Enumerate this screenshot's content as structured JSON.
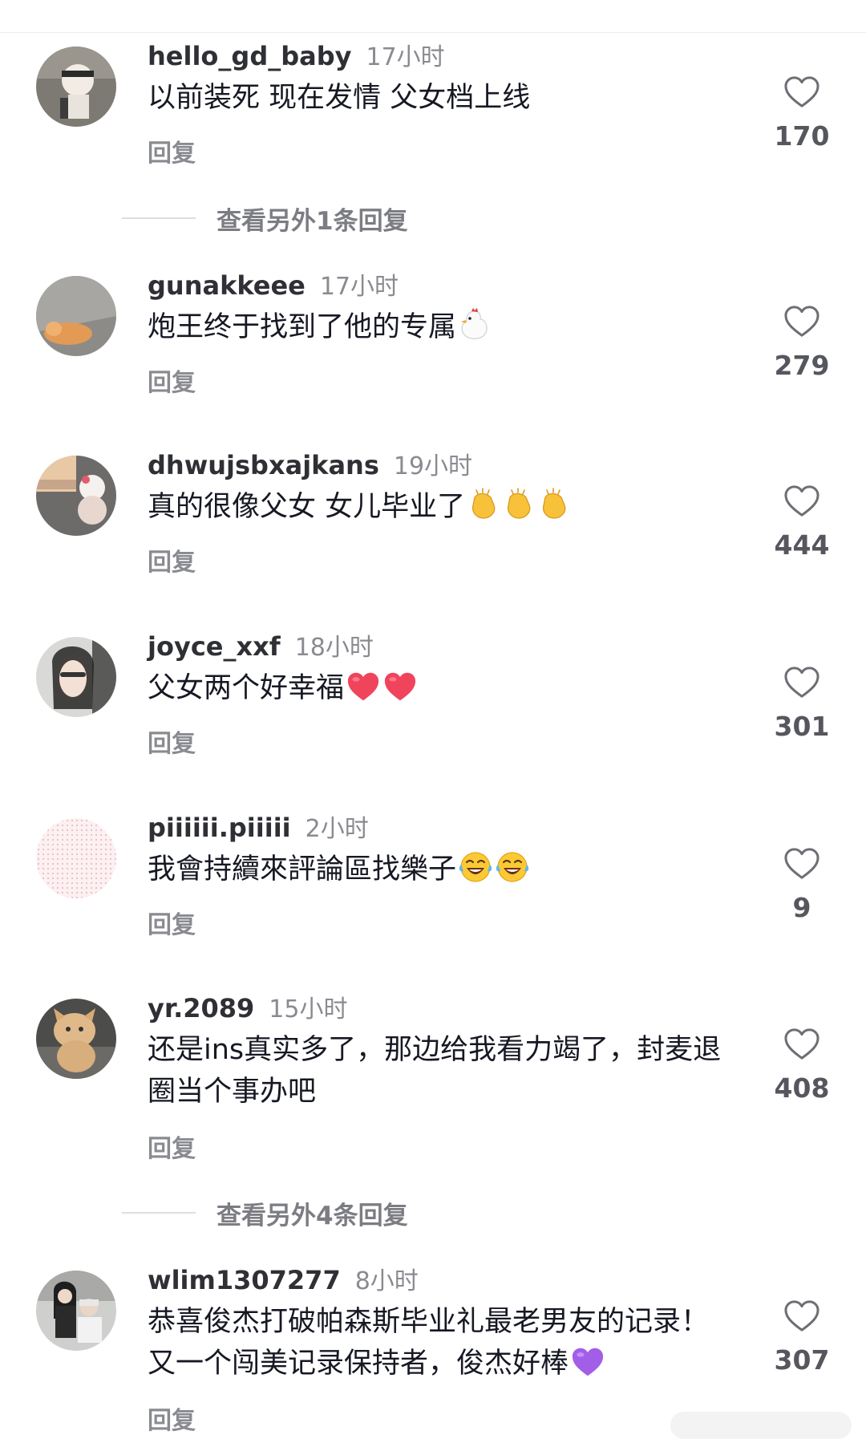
{
  "reply_label": "回复",
  "comments": [
    {
      "user": "hello_gd_baby",
      "time": "17小时",
      "text": "以前装死  现在发情 父女档上线",
      "likes": "170",
      "emoji": []
    },
    {
      "user": "gunakkeee",
      "time": "17小时",
      "text": "炮王终于找到了他的专属",
      "likes": "279",
      "emoji": [
        "chicken"
      ]
    },
    {
      "user": "dhwujsbxajkans",
      "time": "19小时",
      "text": "真的很像父女 女儿毕业了",
      "likes": "444",
      "emoji": [
        "clap",
        "clap",
        "clap"
      ]
    },
    {
      "user": "joyce_xxf",
      "time": "18小时",
      "text": "父女两个好幸福",
      "likes": "301",
      "emoji": [
        "heart-red",
        "heart-red"
      ]
    },
    {
      "user": "piiiiii.piiiii",
      "time": "2小时",
      "text": "我會持續來評論區找樂子",
      "likes": "9",
      "emoji": [
        "laugh",
        "laugh"
      ]
    },
    {
      "user": "yr.2089",
      "time": "15小时",
      "text": "还是ins真实多了，那边给我看力竭了，封麦退圈当个事办吧",
      "likes": "408",
      "emoji": []
    },
    {
      "user": "wlim1307277",
      "time": "8小时",
      "text": "恭喜俊杰打破帕森斯毕业礼最老男友的记录！又一个闯美记录保持者，俊杰好棒",
      "likes": "307",
      "emoji": [
        "heart-purple"
      ]
    }
  ],
  "more_replies": [
    {
      "label": "查看另外1条回复"
    },
    {
      "label": "查看另外4条回复"
    }
  ],
  "colors": {
    "text": "#161823",
    "username": "#2f3035",
    "muted": "#8a8b91",
    "divider": "#dedede",
    "heart_red": "#f0445c",
    "heart_purple": "#a35ee8"
  }
}
